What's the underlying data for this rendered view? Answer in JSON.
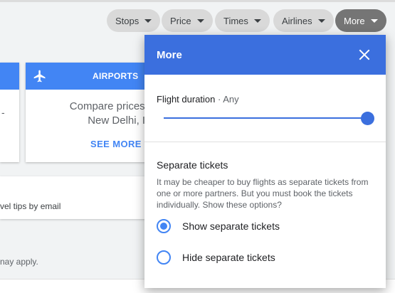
{
  "filters": {
    "chips": [
      {
        "label": "Stops"
      },
      {
        "label": "Price"
      },
      {
        "label": "Times"
      },
      {
        "label": "Airlines"
      },
      {
        "label": "More"
      }
    ]
  },
  "background": {
    "airports_card": {
      "title": "AIRPORTS",
      "body_line1": "Compare prices for air",
      "body_line2": "New Delhi, Ind",
      "action": "SEE MORE"
    },
    "tips_text": "vel tips by email",
    "footnote": "nay apply."
  },
  "more_panel": {
    "title": "More",
    "flight_duration": {
      "label": "Flight duration",
      "separator": " · ",
      "value": "Any",
      "slider_fraction": 1.0
    },
    "separate_tickets": {
      "title": "Separate tickets",
      "description": "It may be cheaper to buy flights as separate tickets from one or more partners. But you must book the tickets individually. Show these options?",
      "options": [
        {
          "label": "Show separate tickets",
          "selected": true
        },
        {
          "label": "Hide separate tickets",
          "selected": false
        }
      ]
    }
  },
  "colors": {
    "accent": "#3b6fde",
    "radio": "#4285f4",
    "card_header": "#4285f4",
    "chip_active": "#757575"
  }
}
